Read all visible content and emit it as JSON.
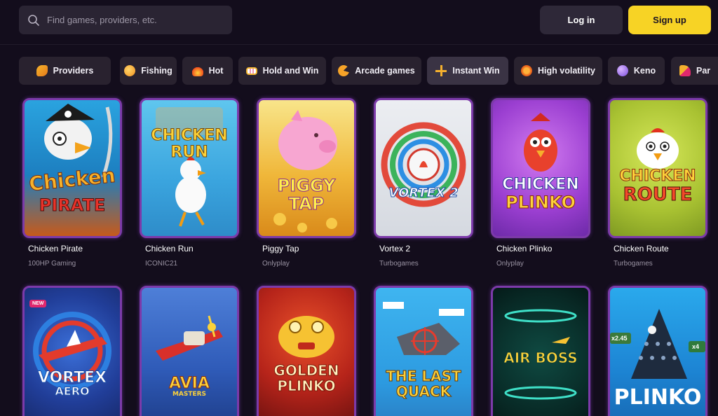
{
  "header": {
    "search_placeholder": "Find games, providers, etc.",
    "login_label": "Log in",
    "signup_label": "Sign up"
  },
  "categories": [
    {
      "label": "Providers",
      "icon": "providers-icon"
    },
    {
      "label": "Fishing",
      "icon": "fishing-icon"
    },
    {
      "label": "Hot",
      "icon": "fire-icon"
    },
    {
      "label": "Hold and Win",
      "icon": "slot-reels-icon"
    },
    {
      "label": "Arcade games",
      "icon": "arcade-icon"
    },
    {
      "label": "Instant Win",
      "icon": "sparkle-icon"
    },
    {
      "label": "High volatility",
      "icon": "volatility-icon"
    },
    {
      "label": "Keno",
      "icon": "keno-ball-icon"
    },
    {
      "label": "Par",
      "icon": "party-icon"
    }
  ],
  "games": [
    {
      "name": "Chicken Pirate",
      "provider": "100HP Gaming",
      "art_lines": [
        "Chicken",
        "PIRATE"
      ]
    },
    {
      "name": "Chicken Run",
      "provider": "ICONIC21",
      "art_lines": [
        "CHICKEN",
        "RUN"
      ]
    },
    {
      "name": "Piggy Tap",
      "provider": "Onlyplay",
      "art_lines": [
        "PIGGY",
        "TAP"
      ]
    },
    {
      "name": "Vortex 2",
      "provider": "Turbogames",
      "art_lines": [
        "VORTEX 2"
      ]
    },
    {
      "name": "Chicken Plinko",
      "provider": "Onlyplay",
      "art_lines": [
        "CHICKEN",
        "PLINKO"
      ]
    },
    {
      "name": "Chicken Route",
      "provider": "Turbogames",
      "art_lines": [
        "CHICKEN",
        "ROUTE"
      ]
    }
  ],
  "games_row2": [
    {
      "art_lines": [
        "VORTEX",
        "AERO"
      ],
      "badge": "NEW"
    },
    {
      "art_lines": [
        "AVIA",
        "MASTERS"
      ]
    },
    {
      "art_lines": [
        "GOLDEN",
        "PLINKO"
      ]
    },
    {
      "art_lines": [
        "THE LAST",
        "QUACK"
      ]
    },
    {
      "art_lines": [
        "AIR BOSS"
      ]
    },
    {
      "art_lines": [
        "PLINKO"
      ],
      "multipliers": [
        "x2.45",
        "x4"
      ]
    }
  ],
  "colors": {
    "background": "#130d1c",
    "accent": "#f7d325",
    "card_border": "#7c3aa9"
  }
}
